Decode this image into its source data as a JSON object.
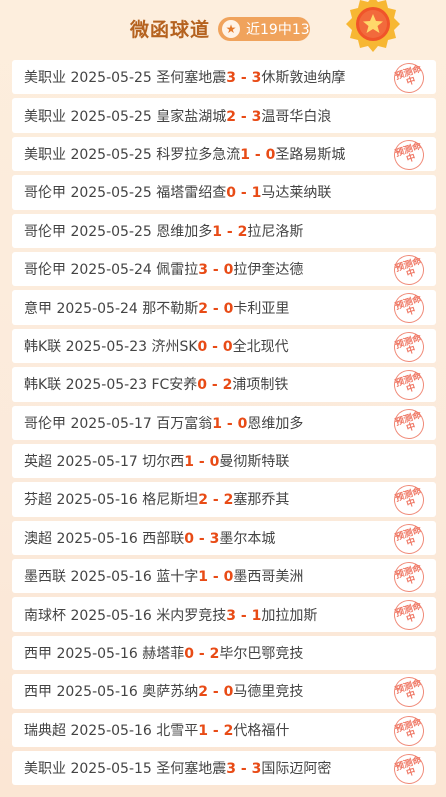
{
  "header": {
    "title": "微函球道",
    "record": "近19中13",
    "star_icon": "star-icon",
    "medal_icon": "medal-icon"
  },
  "stamp_label": "预测命中",
  "matches": [
    {
      "league": "美职业",
      "date": "2025-05-25",
      "home": "圣何塞地震",
      "home_score": "3",
      "away_score": "3",
      "away": "休斯敦迪纳摩",
      "hit": true
    },
    {
      "league": "美职业",
      "date": "2025-05-25",
      "home": "皇家盐湖城",
      "home_score": "2",
      "away_score": "3",
      "away": "温哥华白浪",
      "hit": false
    },
    {
      "league": "美职业",
      "date": "2025-05-25",
      "home": "科罗拉多急流",
      "home_score": "1",
      "away_score": "0",
      "away": "圣路易斯城",
      "hit": true
    },
    {
      "league": "哥伦甲",
      "date": "2025-05-25",
      "home": "福塔雷绍查",
      "home_score": "0",
      "away_score": "1",
      "away": "马达莱纳联",
      "hit": false
    },
    {
      "league": "哥伦甲",
      "date": "2025-05-25",
      "home": "恩维加多",
      "home_score": "1",
      "away_score": "2",
      "away": "拉尼洛斯",
      "hit": false
    },
    {
      "league": "哥伦甲",
      "date": "2025-05-24",
      "home": "佩雷拉",
      "home_score": "3",
      "away_score": "0",
      "away": "拉伊奎达德",
      "hit": true
    },
    {
      "league": "意甲",
      "date": "2025-05-24",
      "home": "那不勒斯",
      "home_score": "2",
      "away_score": "0",
      "away": "卡利亚里",
      "hit": true
    },
    {
      "league": "韩K联",
      "date": "2025-05-23",
      "home": "济州SK",
      "home_score": "0",
      "away_score": "0",
      "away": "全北现代",
      "hit": true
    },
    {
      "league": "韩K联",
      "date": "2025-05-23",
      "home": "FC安养",
      "home_score": "0",
      "away_score": "2",
      "away": "浦项制铁",
      "hit": true
    },
    {
      "league": "哥伦甲",
      "date": "2025-05-17",
      "home": "百万富翁",
      "home_score": "1",
      "away_score": "0",
      "away": "恩维加多",
      "hit": true
    },
    {
      "league": "英超",
      "date": "2025-05-17",
      "home": "切尔西",
      "home_score": "1",
      "away_score": "0",
      "away": "曼彻斯特联",
      "hit": false
    },
    {
      "league": "芬超",
      "date": "2025-05-16",
      "home": "格尼斯坦",
      "home_score": "2",
      "away_score": "2",
      "away": "塞那乔其",
      "hit": true
    },
    {
      "league": "澳超",
      "date": "2025-05-16",
      "home": "西部联",
      "home_score": "0",
      "away_score": "3",
      "away": "墨尔本城",
      "hit": true
    },
    {
      "league": "墨西联",
      "date": "2025-05-16",
      "home": "蓝十字",
      "home_score": "1",
      "away_score": "0",
      "away": "墨西哥美洲",
      "hit": true
    },
    {
      "league": "南球杯",
      "date": "2025-05-16",
      "home": "米内罗竞技",
      "home_score": "3",
      "away_score": "1",
      "away": "加拉加斯",
      "hit": true
    },
    {
      "league": "西甲",
      "date": "2025-05-16",
      "home": "赫塔菲",
      "home_score": "0",
      "away_score": "2",
      "away": "毕尔巴鄂竞技",
      "hit": false
    },
    {
      "league": "西甲",
      "date": "2025-05-16",
      "home": "奥萨苏纳",
      "home_score": "2",
      "away_score": "0",
      "away": "马德里竞技",
      "hit": true
    },
    {
      "league": "瑞典超",
      "date": "2025-05-16",
      "home": "北雪平",
      "home_score": "1",
      "away_score": "2",
      "away": "代格福什",
      "hit": true
    },
    {
      "league": "美职业",
      "date": "2025-05-15",
      "home": "圣何塞地震",
      "home_score": "3",
      "away_score": "3",
      "away": "国际迈阿密",
      "hit": true
    }
  ],
  "colors": {
    "accent": "#e84b16",
    "title": "#b5621f",
    "pill": "#f0a35c",
    "stamp": "#ef7764"
  }
}
